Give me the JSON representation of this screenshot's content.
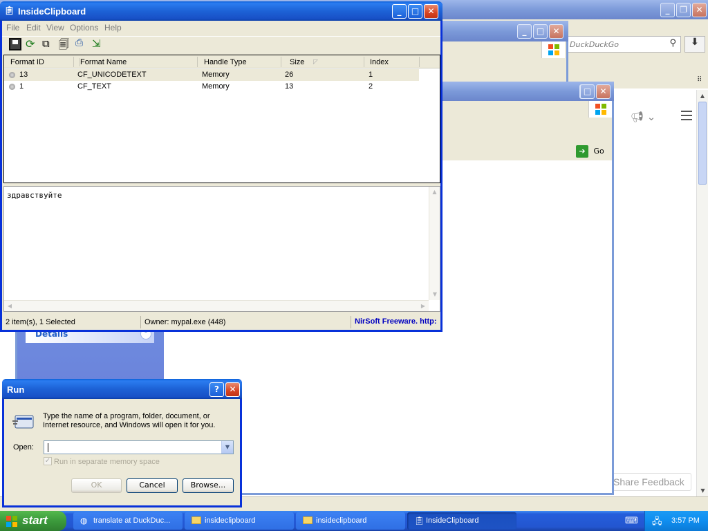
{
  "browser": {
    "search_placeholder": "DuckDuckGo",
    "share_feedback": "Share Feedback"
  },
  "ie_back": {
    "go_label": "Go"
  },
  "ie_mid": {
    "go_label": "Go",
    "side_panel_details": "Details"
  },
  "inside_clipboard": {
    "title": "InsideClipboard",
    "menu": [
      "File",
      "Edit",
      "View",
      "Options",
      "Help"
    ],
    "columns": [
      "Format ID",
      "Format Name",
      "Handle Type",
      "Size",
      "Index"
    ],
    "rows": [
      {
        "format_id": "13",
        "format_name": "CF_UNICODETEXT",
        "handle_type": "Memory",
        "size": "26",
        "index": "1"
      },
      {
        "format_id": "1",
        "format_name": "CF_TEXT",
        "handle_type": "Memory",
        "size": "13",
        "index": "2"
      }
    ],
    "preview_text": "здравствуйте",
    "status_items": "2 item(s), 1 Selected",
    "status_owner": "Owner: mypal.exe (448)",
    "status_link": "NirSoft Freeware. http:"
  },
  "run_dialog": {
    "title": "Run",
    "description": "Type the name of a program, folder, document, or Internet resource, and Windows will open it for you.",
    "open_label": "Open:",
    "open_value": "",
    "checkbox_label": "Run in separate memory space",
    "ok": "OK",
    "cancel": "Cancel",
    "browse": "Browse..."
  },
  "taskbar": {
    "start": "start",
    "items": [
      "translate at DuckDuc...",
      "insideclipboard",
      "insideclipboard",
      "InsideClipboard"
    ],
    "clock": "3:57 PM"
  },
  "colors": {
    "xp_blue": "#245edb",
    "taskbar_blue": "#245ddb",
    "start_green": "#3c9a3c",
    "tray_blue": "#0f8ef0",
    "nirsoft_link": "#0000c0"
  }
}
